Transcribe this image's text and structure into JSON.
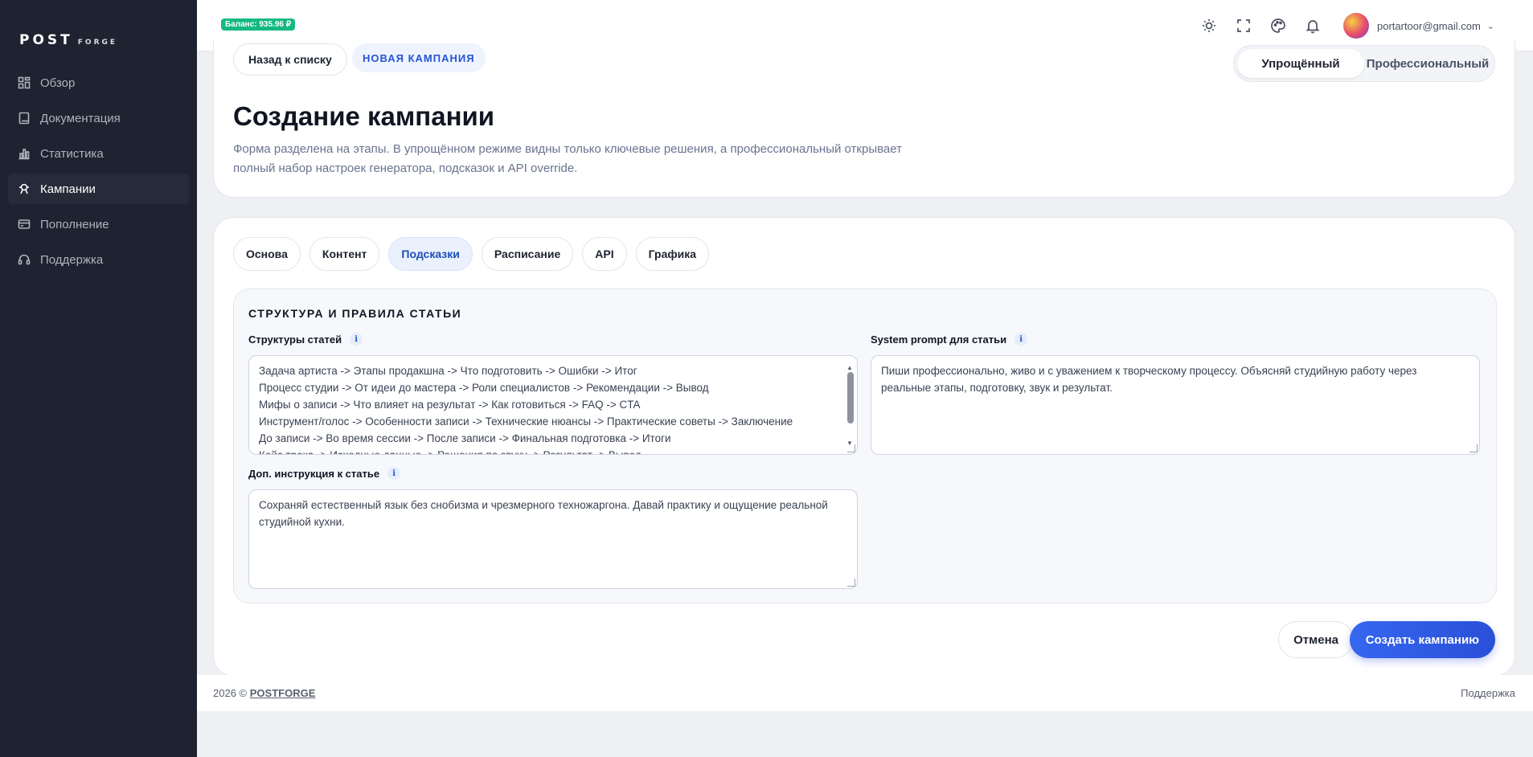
{
  "app": {
    "logo_main": "POST",
    "logo_sub": "FORGE"
  },
  "sidebar": {
    "items": [
      {
        "label": "Обзор",
        "icon": "grid-icon"
      },
      {
        "label": "Документация",
        "icon": "book-icon"
      },
      {
        "label": "Статистика",
        "icon": "bar-chart-icon"
      },
      {
        "label": "Кампании",
        "icon": "rocket-icon",
        "active": true
      },
      {
        "label": "Пополнение",
        "icon": "card-icon"
      },
      {
        "label": "Поддержка",
        "icon": "headset-icon"
      }
    ]
  },
  "topbar": {
    "balance": "Баланс: 935.96 ₽",
    "user_email": "portartoor@gmail.com",
    "icons": [
      "sun-icon",
      "fullscreen-icon",
      "palette-icon",
      "bell-icon"
    ]
  },
  "header": {
    "back_label": "Назад к списку",
    "badge": "НОВАЯ КАМПАНИЯ",
    "mode_simple": "Упрощённый",
    "mode_pro": "Профессиональный",
    "title": "Создание кампании",
    "description": "Форма разделена на этапы. В упрощённом режиме видны только ключевые решения, а профессиональный открывает полный набор настроек генератора, подсказок и API override."
  },
  "tabs": [
    "Основа",
    "Контент",
    "Подсказки",
    "Расписание",
    "API",
    "Графика"
  ],
  "active_tab": "Подсказки",
  "section": {
    "title": "СТРУКТУРА И ПРАВИЛА СТАТЬИ",
    "structures_label": "Структуры статей",
    "structures_lines": [
      "Задача артиста -> Этапы продакшна -> Что подготовить -> Ошибки -> Итог",
      "Процесс студии -> От идеи до мастера -> Роли специалистов -> Рекомендации -> Вывод",
      "Мифы о записи -> Что влияет на результат -> Как готовиться -> FAQ -> CTA",
      "Инструмент/голос -> Особенности записи -> Технические нюансы -> Практические советы -> Заключение",
      "До записи -> Во время сессии -> После записи -> Финальная подготовка -> Итоги",
      "Кейс трека -> Исходные данные -> Решения по звуку -> Результат -> Вывод"
    ],
    "system_prompt_label": "System prompt для статьи",
    "system_prompt_value": "Пиши профессионально, живо и с уважением к творческому процессу. Объясняй студийную работу через реальные этапы, подготовку, звук и результат.",
    "extra_label": "Доп. инструкция к статье",
    "extra_value": "Сохраняй естественный язык без снобизма и чрезмерного техножаргона. Давай практику и ощущение реальной студийной кухни."
  },
  "actions": {
    "cancel": "Отмена",
    "create": "Создать кампанию"
  },
  "footer": {
    "copyright": "2026 ©",
    "brand": "POSTFORGE",
    "support": "Поддержка"
  }
}
